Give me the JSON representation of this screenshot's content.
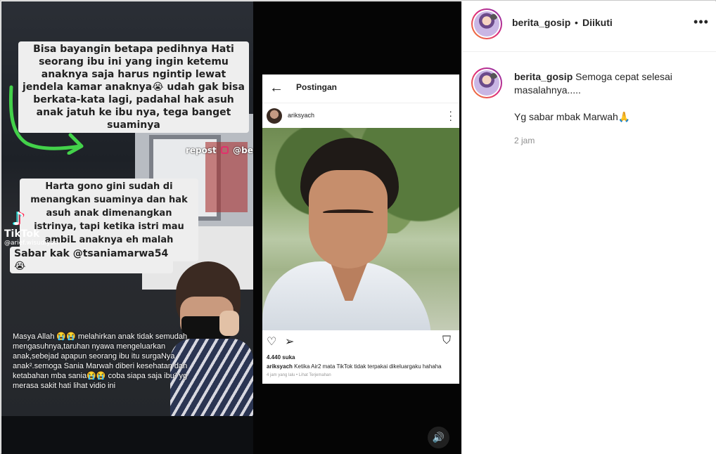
{
  "post": {
    "username": "berita_gosip",
    "separator": "•",
    "follow_state": "Diikuti",
    "more_icon": "more-horizontal-icon"
  },
  "media": {
    "caption_top": "Bisa bayangin betapa pedihnya Hati seorang ibu ini yang  ingin ketemu anaknya saja harus ngintip lewat jendela kamar anaknya😭 udah gak bisa berkata-kata lagi, padahal hak asuh anak jatuh ke ibu nya, tega banget suaminya",
    "caption_mid": "Harta gono gini sudah di menangkan suaminya dan hak asuh anak dimenangkan istrinya, tapi ketika istri mau ambiL anaknya eh malah dipersulit 😭",
    "caption_tag": "Sabar kak @tsaniamarwa54 😭",
    "repost_label": "repost",
    "repost_handle": "@berita_gosip",
    "tiktok_brand": "TikTok",
    "tiktok_user": "@arief.wisudiyan",
    "comment_overlay": "Masya Allah 😭😭 melahirkan anak tidak semudah mengasuhnya,taruhan nyawa mengeluarkan anak,sebejad apapun seorang ibu itu surgaNya  anak².semoga Sania Marwah diberi kesehatan dan ketabahan mba sania😭😭 coba siapa saja ibu² yg merasa sakit hati lihat vidio ini",
    "embedded_post": {
      "title": "Postingan",
      "username": "ariksyach",
      "likes": "4.440 suka",
      "caption_user": "ariksyach",
      "caption_text": "Ketika Air2 mata TikTok tidak terpakai dikeluargaku hahaha",
      "meta": "4 jam yang lalu • Lihat Terjemahan"
    },
    "volume_icon": "volume-icon"
  },
  "comment": {
    "username": "berita_gosip",
    "text_line1": "Semoga cepat selesai masalahnya.....",
    "text_line2": "Yg sabar mbak Marwah",
    "emoji": "🙏",
    "time": "2 jam"
  },
  "colors": {
    "accent_gradient": [
      "#f58529",
      "#dd2a7b",
      "#8134af"
    ],
    "secondary_text": "#8e8e8e",
    "primary_text": "#262626"
  }
}
